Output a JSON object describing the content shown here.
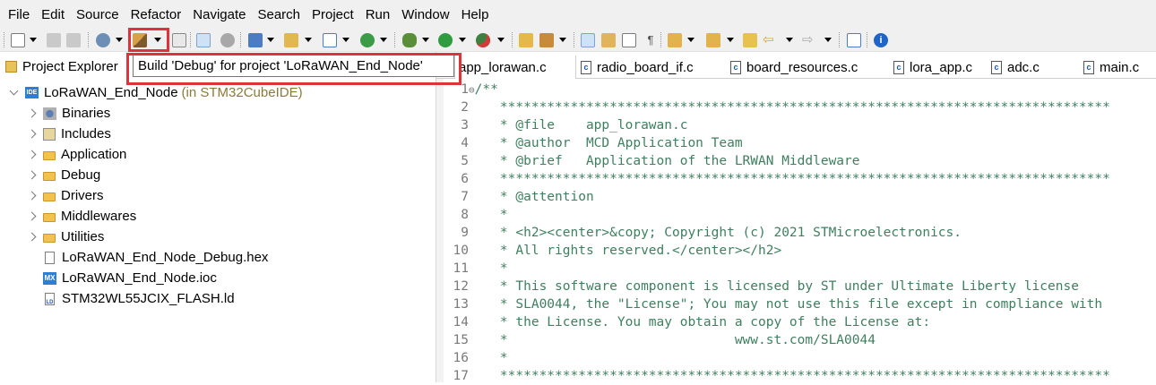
{
  "menu": [
    "File",
    "Edit",
    "Source",
    "Refactor",
    "Navigate",
    "Search",
    "Project",
    "Run",
    "Window",
    "Help"
  ],
  "tooltip": "Build 'Debug' for project 'LoRaWAN_End_Node'",
  "project_explorer": {
    "tab_label": "Project Explorer",
    "root": {
      "name": "LoRaWAN_End_Node",
      "suffix": "(in STM32CubeIDE)"
    },
    "items": [
      {
        "label": "Binaries",
        "icon": "binaries-icon",
        "expandable": true
      },
      {
        "label": "Includes",
        "icon": "includes-icon",
        "expandable": true
      },
      {
        "label": "Application",
        "icon": "folder-icon",
        "expandable": true
      },
      {
        "label": "Debug",
        "icon": "folder-icon",
        "expandable": true
      },
      {
        "label": "Drivers",
        "icon": "folder-icon",
        "expandable": true
      },
      {
        "label": "Middlewares",
        "icon": "folder-icon",
        "expandable": true
      },
      {
        "label": "Utilities",
        "icon": "folder-icon",
        "expandable": true
      },
      {
        "label": "LoRaWAN_End_Node_Debug.hex",
        "icon": "file-icon",
        "expandable": false
      },
      {
        "label": "LoRaWAN_End_Node.ioc",
        "icon": "mx-icon",
        "expandable": false
      },
      {
        "label": "STM32WL55JCIX_FLASH.ld",
        "icon": "linker-file-icon",
        "expandable": false
      }
    ]
  },
  "editor_tabs": [
    "app_lorawan.c",
    "radio_board_if.c",
    "board_resources.c",
    "lora_app.c",
    "adc.c",
    "main.c"
  ],
  "code": [
    {
      "n": "1",
      "text": "/**"
    },
    {
      "n": "2",
      "text": "  ******************************************************************************"
    },
    {
      "n": "3",
      "text": "  * @file    app_lorawan.c"
    },
    {
      "n": "4",
      "text": "  * @author  MCD Application Team"
    },
    {
      "n": "5",
      "text": "  * @brief   Application of the LRWAN Middleware"
    },
    {
      "n": "6",
      "text": "  ******************************************************************************"
    },
    {
      "n": "7",
      "text": "  * @attention"
    },
    {
      "n": "8",
      "text": "  *"
    },
    {
      "n": "9",
      "text": "  * <h2><center>&copy; Copyright (c) 2021 STMicroelectronics."
    },
    {
      "n": "10",
      "text": "  * All rights reserved.</center></h2>"
    },
    {
      "n": "11",
      "text": "  *"
    },
    {
      "n": "12",
      "text": "  * This software component is licensed by ST under Ultimate Liberty license"
    },
    {
      "n": "13",
      "text": "  * SLA0044, the \"License\"; You may not use this file except in compliance with"
    },
    {
      "n": "14",
      "text": "  * the License. You may obtain a copy of the License at:"
    },
    {
      "n": "15",
      "text": "  *                             www.st.com/SLA0044"
    },
    {
      "n": "16",
      "text": "  *"
    },
    {
      "n": "17",
      "text": "  ******************************************************************************"
    }
  ],
  "colors": {
    "highlight": "#e0323a",
    "comment": "#3f7f5f"
  }
}
